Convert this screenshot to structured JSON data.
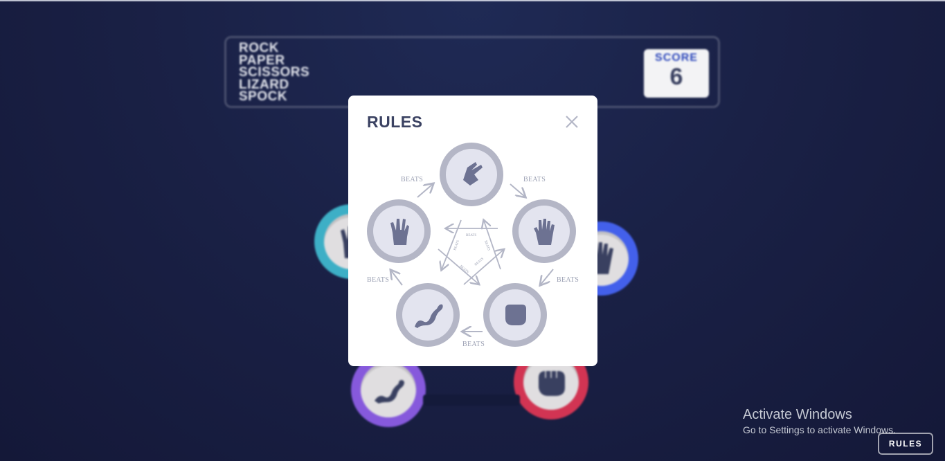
{
  "header": {
    "logo_lines": [
      "ROCK",
      "PAPER",
      "SCISSORS",
      "LIZARD",
      "SPOCK"
    ],
    "score_label": "SCORE",
    "score_value": "6"
  },
  "rules_button_label": "RULES",
  "modal": {
    "title": "RULES",
    "beats_label": "BEATS"
  },
  "windows_notice": {
    "title": "Activate Windows",
    "subtitle": "Go to Settings to activate Windows."
  },
  "colors": {
    "spock": "#3fb7cd",
    "paper": "#4664f4",
    "lizard": "#8c5de5",
    "rock": "#dc3654",
    "modal_token_ring": "#b4b6c6",
    "modal_token_inner": "#e3e4ef",
    "icon_dark": "#3b4262",
    "icon_modal": "#6d7292"
  },
  "icons": [
    "scissors-icon",
    "paper-icon",
    "rock-icon",
    "lizard-icon",
    "spock-icon",
    "close-icon"
  ]
}
